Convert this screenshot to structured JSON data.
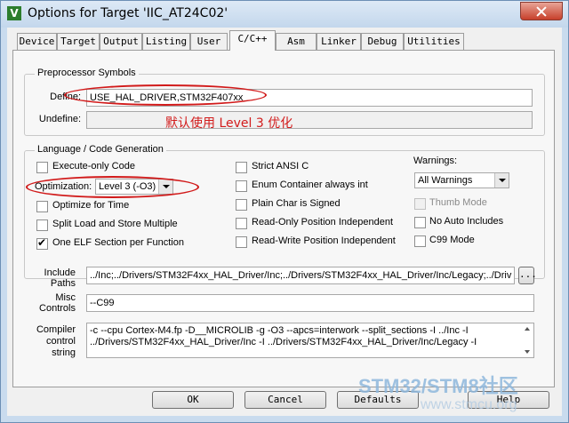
{
  "window": {
    "title": "Options for Target 'IIC_AT24C02'",
    "icon": "keil-uvision-icon"
  },
  "tabs": [
    {
      "label": "Device"
    },
    {
      "label": "Target"
    },
    {
      "label": "Output"
    },
    {
      "label": "Listing"
    },
    {
      "label": "User"
    },
    {
      "label": "C/C++",
      "active": true
    },
    {
      "label": "Asm"
    },
    {
      "label": "Linker"
    },
    {
      "label": "Debug"
    },
    {
      "label": "Utilities"
    }
  ],
  "preprocessor": {
    "title": "Preprocessor Symbols",
    "define_label": "Define:",
    "define_value": "USE_HAL_DRIVER,STM32F407xx",
    "undefine_label": "Undefine:",
    "undefine_value": ""
  },
  "annotation": {
    "text": "默认使用 Level 3 优化",
    "color": "#d21b1b"
  },
  "language": {
    "title": "Language / Code Generation",
    "execute_only": {
      "label": "Execute-only Code",
      "checked": false
    },
    "optimization": {
      "label": "Optimization:",
      "value": "Level 3 (-O3)"
    },
    "optimize_time": {
      "label": "Optimize for Time",
      "checked": false
    },
    "split_load": {
      "label": "Split Load and Store Multiple",
      "checked": false
    },
    "one_elf": {
      "label": "One ELF Section per Function",
      "checked": true
    },
    "strict_ansi": {
      "label": "Strict ANSI C",
      "checked": false
    },
    "enum_container": {
      "label": "Enum Container always int",
      "checked": false
    },
    "plain_char": {
      "label": "Plain Char is Signed",
      "checked": false
    },
    "ro_pi": {
      "label": "Read-Only Position Independent",
      "checked": false
    },
    "rw_pi": {
      "label": "Read-Write Position Independent",
      "checked": false
    },
    "warnings_label": "Warnings:",
    "warnings_value": "All Warnings",
    "thumb_mode": {
      "label": "Thumb Mode",
      "checked": false,
      "disabled": true
    },
    "no_auto_includes": {
      "label": "No Auto Includes",
      "checked": false
    },
    "c99_mode": {
      "label": "C99 Mode",
      "checked": false
    }
  },
  "include_paths": {
    "label_line1": "Include",
    "label_line2": "Paths",
    "value": "../Inc;../Drivers/STM32F4xx_HAL_Driver/Inc;../Drivers/STM32F4xx_HAL_Driver/Inc/Legacy;../Driv",
    "browse_label": "..."
  },
  "misc_controls": {
    "label_line1": "Misc",
    "label_line2": "Controls",
    "value": "--C99"
  },
  "compiler_control": {
    "label_line1": "Compiler",
    "label_line2": "control",
    "label_line3": "string",
    "line1": "-c --cpu Cortex-M4.fp -D__MICROLIB -g -O3 --apcs=interwork --split_sections -I ../Inc -I",
    "line2": "../Drivers/STM32F4xx_HAL_Driver/Inc -I ../Drivers/STM32F4xx_HAL_Driver/Inc/Legacy -I"
  },
  "buttons": {
    "ok": "OK",
    "cancel": "Cancel",
    "defaults": "Defaults",
    "help": "Help"
  },
  "watermark": {
    "line1": "STM32/STM8社区",
    "line2": "www.stmcu.org"
  }
}
